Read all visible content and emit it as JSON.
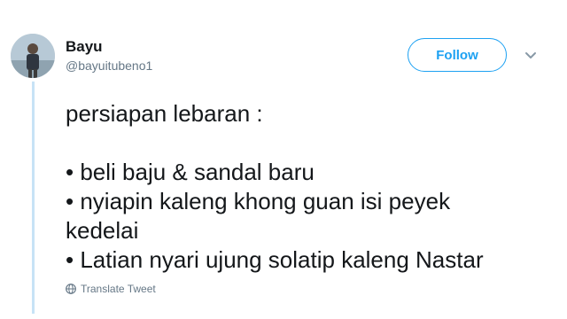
{
  "user": {
    "display_name": "Bayu",
    "handle": "@bayuitubeno1"
  },
  "follow": {
    "label": "Follow"
  },
  "tweet": {
    "lines": [
      "persiapan lebaran :",
      "• beli baju & sandal baru",
      "• nyiapin kaleng khong guan isi peyek",
      "kedelai",
      "• Latian nyari ujung solatip kaleng Nastar"
    ]
  },
  "translate": {
    "label": "Translate Tweet"
  },
  "icons": {
    "avatar": "avatar",
    "caret": "chevron-down-icon",
    "globe": "globe-icon"
  },
  "colors": {
    "accent": "#1da1f2",
    "thread_line": "#c7e3f6",
    "text": "#14171a",
    "muted": "#657786"
  }
}
